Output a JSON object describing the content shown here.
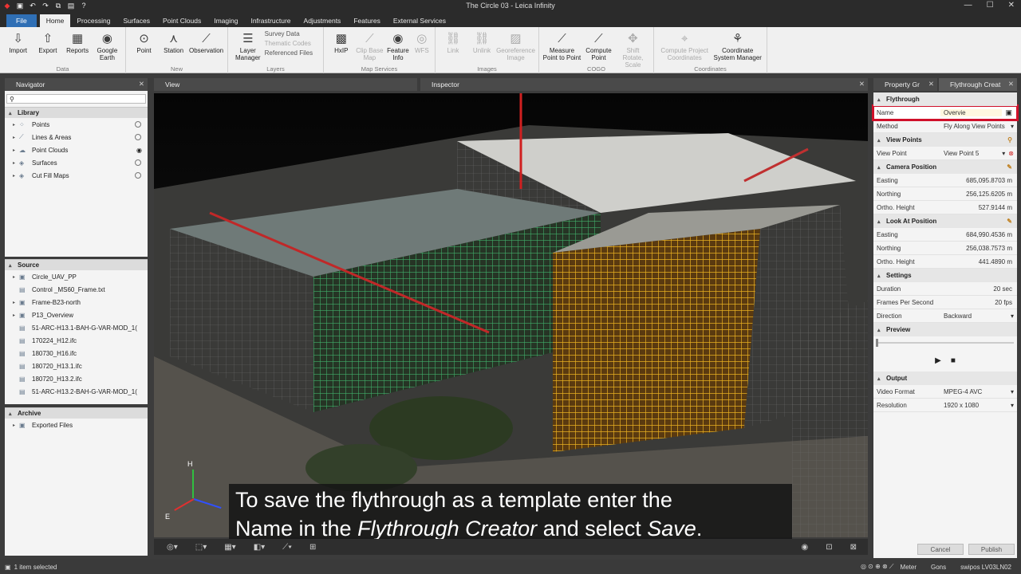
{
  "window": {
    "title": "The Circle 03 - Leica Infinity"
  },
  "menu": {
    "tabs": [
      "File",
      "Home",
      "Processing",
      "Surfaces",
      "Point Clouds",
      "Imaging",
      "Infrastructure",
      "Adjustments",
      "Features",
      "External Services"
    ]
  },
  "ribbon": {
    "data": {
      "label": "Data",
      "import": "Import",
      "export": "Export",
      "reports": "Reports",
      "google_earth": "Google Earth"
    },
    "new": {
      "label": "New",
      "point": "Point",
      "station": "Station",
      "observation": "Observation"
    },
    "layers": {
      "label": "Layers",
      "layer_manager": "Layer Manager",
      "survey_data": "Survey Data",
      "thematic_codes": "Thematic Codes",
      "referenced_files": "Referenced Files"
    },
    "map_services": {
      "label": "Map Services",
      "hxip": "HxIP",
      "clip_base_map": "Clip Base Map",
      "feature_info": "Feature Info",
      "wfs": "WFS"
    },
    "images": {
      "label": "Images",
      "link": "Link",
      "unlink": "Unlink",
      "georeference_image": "Georeference Image"
    },
    "cogo": {
      "label": "COGO",
      "measure_point": "Measure Point to Point",
      "compute_point": "Compute Point",
      "shift_rotate_scale": "Shift Rotate, Scale"
    },
    "coordinates": {
      "label": "Coordinates",
      "compute_project_coordinates": "Compute Project Coordinates",
      "coordinate_system_manager": "Coordinate System Manager"
    }
  },
  "navigator": {
    "title": "Navigator",
    "library": {
      "title": "Library",
      "items": [
        "Points",
        "Lines & Areas",
        "Point Clouds",
        "Surfaces",
        "Cut Fill Maps"
      ]
    },
    "source": {
      "title": "Source",
      "items": [
        "Circle_UAV_PP",
        "Control _MS60_Frame.txt",
        "Frame-B23-north",
        "P13_Overview",
        "51-ARC-H13.1-BAH-G-VAR-MOD_1(",
        "170224_H12.ifc",
        "180730_H16.ifc",
        "180720_H13.1.ifc",
        "180720_H13.2.ifc",
        "51-ARC-H13.2-BAH-G-VAR-MOD_1("
      ]
    },
    "archive": {
      "title": "Archive",
      "items": [
        "Exported Files"
      ]
    }
  },
  "view": {
    "tab": "View",
    "inspector_tab": "Inspector"
  },
  "right_panel": {
    "tabs": [
      "Property Gr",
      "Flythrough Creat"
    ],
    "flythrough": {
      "title": "Flythrough",
      "name_label": "Name",
      "name_value": "Overvie",
      "method_label": "Method",
      "method_value": "Fly Along View Points"
    },
    "view_points": {
      "title": "View Points",
      "label": "View Point",
      "value": "View Point 5"
    },
    "camera_position": {
      "title": "Camera Position",
      "easting": "685,095.8703",
      "northing": "256,125.6205",
      "ortho": "527.9144"
    },
    "look_at": {
      "title": "Look At Position",
      "easting": "684,990.4536",
      "northing": "256,038.7573",
      "ortho": "441.4890"
    },
    "labels": {
      "easting": "Easting",
      "northing": "Northing",
      "ortho": "Ortho. Height",
      "unit": "m"
    },
    "settings": {
      "title": "Settings",
      "duration_label": "Duration",
      "duration": "20 sec",
      "fps_label": "Frames Per Second",
      "fps": "20 fps",
      "direction_label": "Direction",
      "direction": "Backward"
    },
    "preview": {
      "title": "Preview"
    },
    "output": {
      "title": "Output",
      "format_label": "Video Format",
      "format": "MPEG-4 AVC",
      "resolution_label": "Resolution",
      "resolution": "1920 x 1080"
    },
    "cancel": "Cancel",
    "publish": "Publish"
  },
  "subtitle": {
    "line1": "To save the flythrough as a template enter the",
    "line2_a": "Name in the ",
    "line2_b": "Flythrough Creator",
    "line2_c": " and select ",
    "line2_d": "Save",
    "line2_e": "."
  },
  "axes": {
    "h": "H",
    "e": "E"
  },
  "status": {
    "selected": "1 item selected",
    "unit": "Meter",
    "angle": "Gons",
    "device": "swipos LV03LN02"
  }
}
